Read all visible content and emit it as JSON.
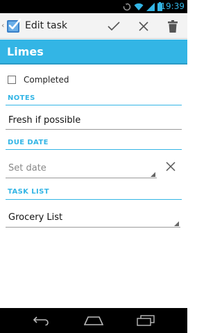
{
  "status_bar": {
    "time": "19:39",
    "icons": [
      "sync-icon",
      "wifi-icon",
      "signal-icon",
      "battery-icon"
    ]
  },
  "action_bar": {
    "title": "Edit task",
    "actions": [
      "check-icon",
      "close-icon",
      "trash-icon"
    ]
  },
  "task": {
    "title": "Limes",
    "completed_label": "Completed",
    "completed": false
  },
  "notes": {
    "header": "NOTES",
    "value": "Fresh if possible"
  },
  "due_date": {
    "header": "DUE DATE",
    "placeholder": "Set date"
  },
  "task_list": {
    "header": "TASK LIST",
    "selected": "Grocery List"
  },
  "colors": {
    "accent": "#33b5e5",
    "status_bar": "#000000",
    "action_bar": "#f3f3f3"
  },
  "nav_bar": {
    "buttons": [
      "back-icon",
      "home-icon",
      "recent-apps-icon"
    ]
  }
}
